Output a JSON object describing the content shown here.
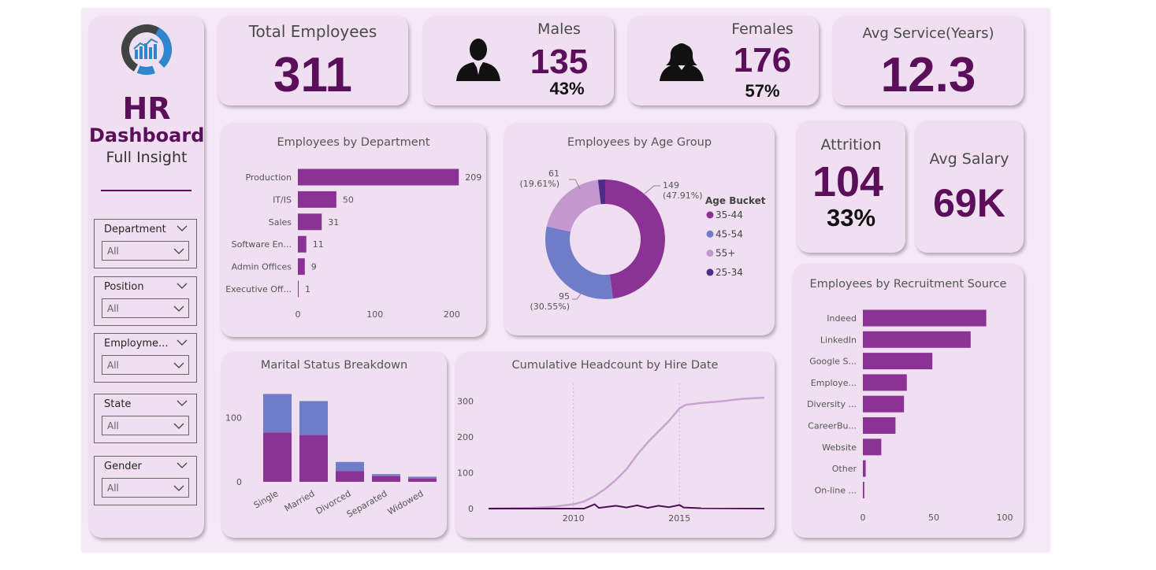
{
  "sidebar": {
    "title": "HR",
    "subtitle": "Dashboard",
    "caption": "Full Insight",
    "slicers": [
      {
        "label": "Department",
        "value": "All"
      },
      {
        "label": "Position",
        "value": "All"
      },
      {
        "label": "Employme...",
        "value": "All"
      },
      {
        "label": "State",
        "value": "All"
      },
      {
        "label": "Gender",
        "value": "All"
      }
    ]
  },
  "kpis": {
    "total": {
      "label": "Total Employees",
      "value": "311"
    },
    "males": {
      "label": "Males",
      "value": "135",
      "pct": "43%"
    },
    "females": {
      "label": "Females",
      "value": "176",
      "pct": "57%"
    },
    "service": {
      "label": "Avg Service(Years)",
      "value": "12.3"
    },
    "attrition": {
      "label": "Attrition",
      "value": "104",
      "pct": "33%"
    },
    "salary": {
      "label": "Avg Salary",
      "value": "69K"
    }
  },
  "colors": {
    "primary": "#8b3394",
    "blue": "#6f7cc7",
    "light": "#c497cf",
    "dark": "#4d2c8c",
    "line_light": "#c9a3d2",
    "line_dark": "#4f0c57",
    "kpi_text": "#5b0f5b"
  },
  "chart_data": [
    {
      "id": "dept",
      "type": "bar",
      "orientation": "horizontal",
      "title": "Employees by Department",
      "categories": [
        "Production",
        "IT/IS",
        "Sales",
        "Software En...",
        "Admin Offices",
        "Executive Off..."
      ],
      "values": [
        209,
        50,
        31,
        11,
        9,
        1
      ],
      "xticks": [
        "0",
        "100",
        "200"
      ],
      "xlim": [
        0,
        218
      ]
    },
    {
      "id": "age",
      "type": "pie",
      "donut": true,
      "title": "Employees by Age Group",
      "legend_title": "Age Bucket",
      "legend_position": "right",
      "labels": [
        "35-44",
        "45-54",
        "55+",
        "25-34"
      ],
      "values": [
        149,
        95,
        61,
        6
      ],
      "data_labels": [
        [
          "149",
          "(47.91%)"
        ],
        [
          "95",
          "(30.55%)"
        ],
        [
          "61",
          "(19.61%)"
        ],
        [
          "",
          ""
        ]
      ]
    },
    {
      "id": "marital",
      "type": "bar",
      "stacked": true,
      "title": "Marital Status Breakdown",
      "categories": [
        "Single",
        "Married",
        "Divorced",
        "Separated",
        "Widowed"
      ],
      "series": [
        {
          "values": [
            77,
            73,
            17,
            9,
            5
          ]
        },
        {
          "values": [
            60,
            53,
            14,
            3,
            3
          ]
        }
      ],
      "yticks": [
        "0",
        "100"
      ],
      "ylim": [
        0,
        140
      ]
    },
    {
      "id": "headcount",
      "type": "line",
      "title": "Cumulative Headcount by Hire Date",
      "yticks": [
        "0",
        "100",
        "200",
        "300"
      ],
      "ylim": [
        0,
        330
      ],
      "xticks": [
        "2010",
        "2015"
      ],
      "xlim": [
        2006,
        2019
      ],
      "series": [
        {
          "x": [
            2006,
            2008,
            2009,
            2010,
            2010.5,
            2011,
            2011.5,
            2012,
            2012.5,
            2013,
            2013.5,
            2014,
            2014.5,
            2015,
            2015.3,
            2016,
            2017,
            2018,
            2019
          ],
          "values": [
            0,
            2,
            5,
            12,
            20,
            35,
            55,
            80,
            110,
            150,
            185,
            215,
            245,
            280,
            290,
            295,
            300,
            307,
            310
          ]
        },
        {
          "x": [
            2006,
            2010.5,
            2011,
            2011.2,
            2012,
            2012.5,
            2013,
            2013.5,
            2014,
            2014.5,
            2015,
            2015.2,
            2016,
            2019
          ],
          "values": [
            0,
            0,
            12,
            2,
            8,
            3,
            9,
            2,
            8,
            4,
            10,
            3,
            1,
            0
          ]
        }
      ]
    },
    {
      "id": "recruit",
      "type": "bar",
      "orientation": "horizontal",
      "title": "Employees by Recruitment Source",
      "categories": [
        "Indeed",
        "LinkedIn",
        "Google S...",
        "Employe...",
        "Diversity ...",
        "CareerBu...",
        "Website",
        "Other",
        "On-line ..."
      ],
      "values": [
        87,
        76,
        49,
        31,
        29,
        23,
        13,
        2,
        1
      ],
      "xticks": [
        "0",
        "50",
        "100"
      ],
      "xlim": [
        0,
        100
      ]
    }
  ]
}
